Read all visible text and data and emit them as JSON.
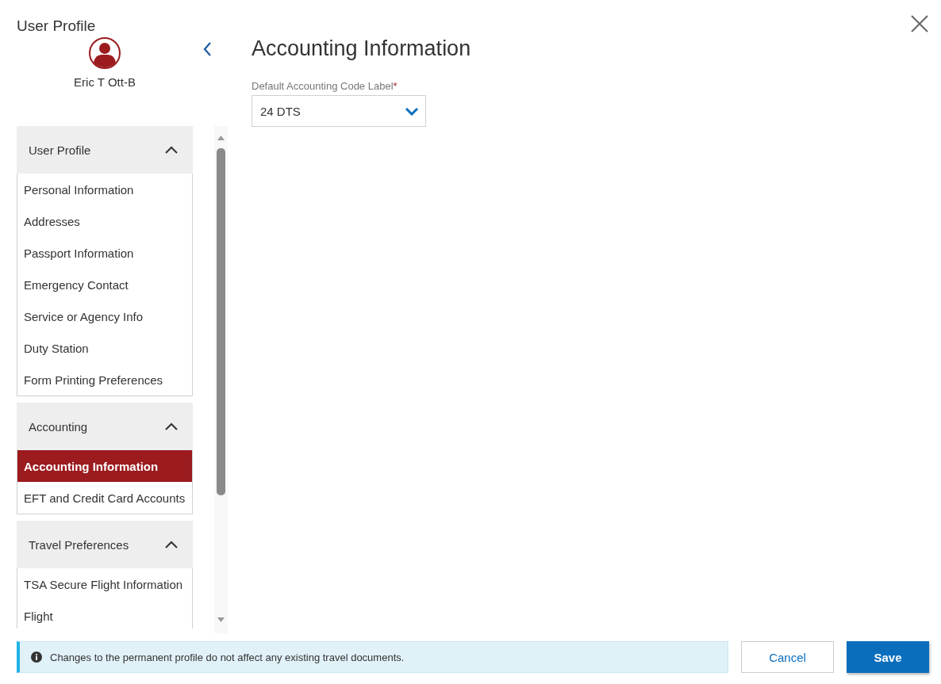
{
  "window": {
    "title": "User Profile"
  },
  "user": {
    "name": "Eric T Ott-B"
  },
  "sections": [
    {
      "title": "User Profile",
      "expanded": true,
      "items": [
        {
          "label": "Personal Information",
          "selected": false
        },
        {
          "label": "Addresses",
          "selected": false
        },
        {
          "label": "Passport Information",
          "selected": false
        },
        {
          "label": "Emergency Contact",
          "selected": false
        },
        {
          "label": "Service or Agency Info",
          "selected": false
        },
        {
          "label": "Duty Station",
          "selected": false
        },
        {
          "label": "Form Printing Preferences",
          "selected": false
        }
      ]
    },
    {
      "title": "Accounting",
      "expanded": true,
      "items": [
        {
          "label": "Accounting Information",
          "selected": true
        },
        {
          "label": "EFT and Credit Card Accounts",
          "selected": false
        }
      ]
    },
    {
      "title": "Travel Preferences",
      "expanded": true,
      "items": [
        {
          "label": "TSA Secure Flight Information",
          "selected": false
        },
        {
          "label": "Flight",
          "selected": false
        }
      ]
    }
  ],
  "main": {
    "heading": "Accounting Information",
    "field": {
      "label": "Default Accounting Code Label",
      "required_mark": "*",
      "value": "24 DTS"
    }
  },
  "footer": {
    "notice": "Changes to the permanent profile do not affect any existing travel documents.",
    "buttons": [
      {
        "label": "Cancel",
        "kind": "secondary"
      },
      {
        "label": "Save",
        "kind": "primary"
      }
    ]
  }
}
